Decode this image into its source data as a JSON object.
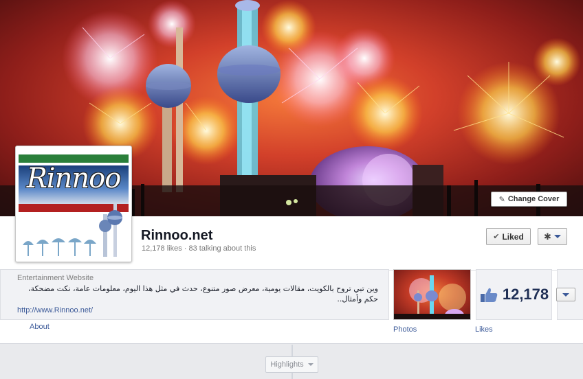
{
  "cover": {
    "change_cover_label": "Change Cover"
  },
  "page": {
    "name": "Rinnoo.net",
    "stats": "12,178 likes · 83 talking about this",
    "logo_text": "Rinnoo"
  },
  "actions": {
    "liked_label": "Liked"
  },
  "about": {
    "category": "Entertainment Website",
    "description": "وين تبي تروح بالكويت، مقالات يومية، معرض صور متنوع، حدث في مثل هذا اليوم، معلومات عامة، نكت مضحكة، حكم وأمثال..",
    "url": "http://www.Rinnoo.net/",
    "about_link": "About"
  },
  "tiles": {
    "photos_label": "Photos",
    "likes_count": "12,178",
    "likes_label": "Likes"
  },
  "timeline": {
    "highlights_label": "Highlights"
  },
  "colors": {
    "link": "#3b5998",
    "cover_primary": "#d2402a"
  },
  "icons": [
    "pencil-icon",
    "check-icon",
    "gear-icon",
    "chevron-down-icon",
    "thumbs-up-icon"
  ]
}
